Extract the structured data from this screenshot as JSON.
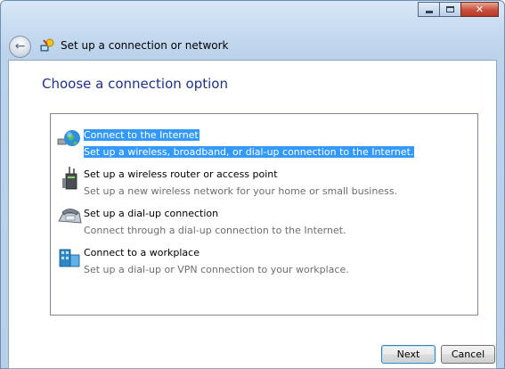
{
  "window": {
    "title": "Set up a connection or network",
    "controls": {
      "minimize": "minimize-icon",
      "maximize": "maximize-icon",
      "close": "close-icon"
    }
  },
  "header": {
    "heading": "Choose a connection option"
  },
  "options": [
    {
      "title": "Connect to the Internet",
      "description": "Set up a wireless, broadband, or dial-up connection to the Internet.",
      "icon": "globe-icon",
      "selected": true
    },
    {
      "title": "Set up a wireless router or access point",
      "description": "Set up a new wireless network for your home or small business.",
      "icon": "router-icon",
      "selected": false
    },
    {
      "title": "Set up a dial-up connection",
      "description": "Connect through a dial-up connection to the Internet.",
      "icon": "phone-icon",
      "selected": false
    },
    {
      "title": "Connect to a workplace",
      "description": "Set up a dial-up or VPN connection to your workplace.",
      "icon": "workplace-icon",
      "selected": false
    }
  ],
  "buttons": {
    "next": "Next",
    "cancel": "Cancel"
  },
  "colors": {
    "selection": "#3399ff",
    "heading": "#1e3287",
    "description": "#6d6d6d"
  }
}
